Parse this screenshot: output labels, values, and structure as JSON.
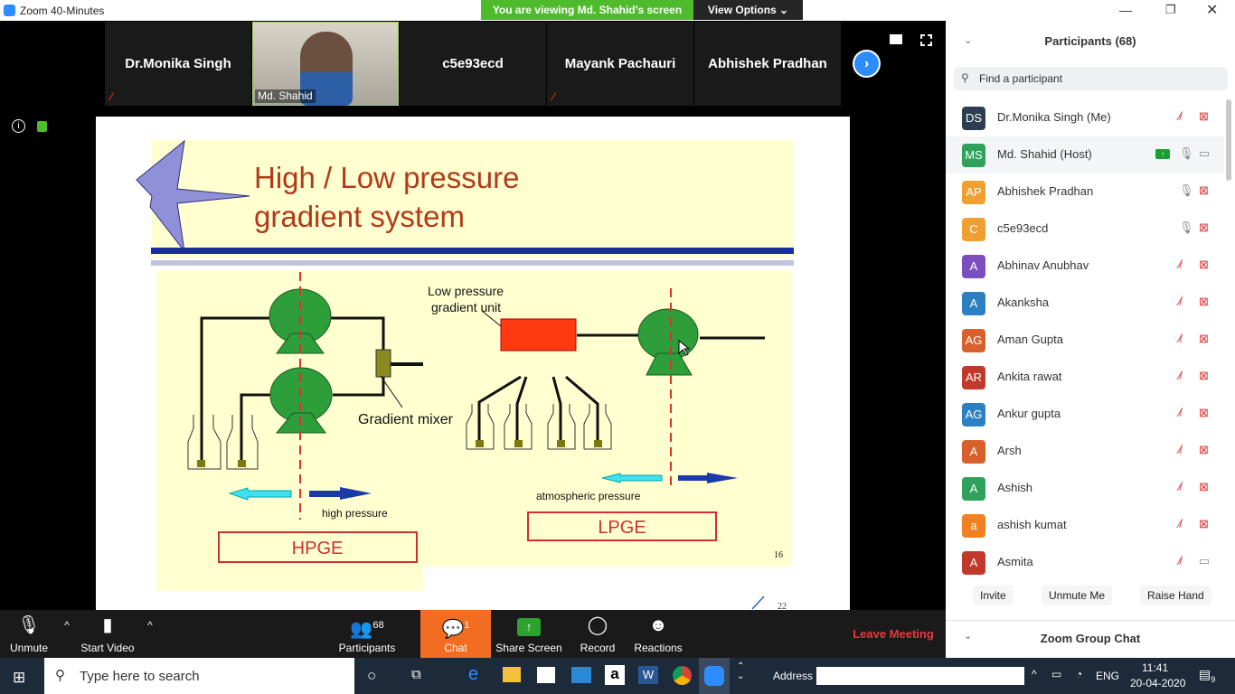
{
  "window": {
    "title": "Zoom 40-Minutes",
    "banner": "You are viewing Md. Shahid's screen",
    "view_options": "View Options ⌄"
  },
  "tiles": [
    {
      "name": "Dr.Monika Singh",
      "muted": true
    },
    {
      "name": "Md. Shahid",
      "video": true
    },
    {
      "name": "c5e93ecd"
    },
    {
      "name": "Mayank Pachauri",
      "muted": true
    },
    {
      "name": "Abhishek Pradhan"
    }
  ],
  "slide": {
    "title_line1": "High / Low pressure",
    "title_line2": "gradient system",
    "lp_unit_line1": "Low pressure",
    "lp_unit_line2": "gradient unit",
    "gradient_mixer": "Gradient mixer",
    "high_pressure": "high pressure",
    "atmospheric_pressure": "atmospheric pressure",
    "hpge": "HPGE",
    "lpge": "LPGE",
    "page_number": "16",
    "outer_page": "22"
  },
  "toolbar": {
    "unmute": "Unmute",
    "start_video": "Start Video",
    "participants": "Participants",
    "participants_count": "68",
    "chat": "Chat",
    "chat_badge": "1",
    "share_screen": "Share Screen",
    "record": "Record",
    "reactions": "Reactions",
    "leave": "Leave Meeting"
  },
  "panel": {
    "title": "Participants (68)",
    "search_placeholder": "Find a participant",
    "invite": "Invite",
    "unmute_me": "Unmute Me",
    "raise_hand": "Raise Hand",
    "group_chat": "Zoom Group Chat",
    "participants": [
      {
        "initials": "DS",
        "name": "Dr.Monika Singh (Me)",
        "color": "#2d3e50",
        "mic": "muted",
        "video": "off"
      },
      {
        "initials": "MS",
        "name": "Md. Shahid (Host)",
        "color": "#2ea25a",
        "mic": "on",
        "video": "on",
        "sharing": true
      },
      {
        "initials": "AP",
        "name": "Abhishek Pradhan",
        "color": "#f0a030",
        "mic": "on",
        "video": "off"
      },
      {
        "initials": "C",
        "name": "c5e93ecd",
        "color": "#f0a030",
        "mic": "on",
        "video": "off"
      },
      {
        "initials": "A",
        "name": "Abhinav Anubhav",
        "color": "#7b4fc0",
        "mic": "muted",
        "video": "off"
      },
      {
        "initials": "A",
        "name": "Akanksha",
        "color": "#2c7fc1",
        "mic": "muted",
        "video": "off"
      },
      {
        "initials": "AG",
        "name": "Aman Gupta",
        "color": "#d8602a",
        "mic": "muted",
        "video": "off"
      },
      {
        "initials": "AR",
        "name": "Ankita rawat",
        "color": "#c0392b",
        "mic": "muted",
        "video": "off"
      },
      {
        "initials": "AG",
        "name": "Ankur gupta",
        "color": "#2c7fc1",
        "mic": "muted",
        "video": "off"
      },
      {
        "initials": "A",
        "name": "Arsh",
        "color": "#d8602a",
        "mic": "muted",
        "video": "off"
      },
      {
        "initials": "A",
        "name": "Ashish",
        "color": "#2ea25a",
        "mic": "muted",
        "video": "off"
      },
      {
        "initials": "a",
        "name": "ashish kumat",
        "color": "#f08020",
        "mic": "muted",
        "video": "off"
      },
      {
        "initials": "A",
        "name": "Asmita",
        "color": "#c0392b",
        "mic": "muted",
        "video": "on"
      }
    ]
  },
  "taskbar": {
    "search_placeholder": "Type here to search",
    "address_label": "Address",
    "lang": "ENG",
    "time": "11:41",
    "date": "20-04-2020",
    "notifications": "9"
  }
}
